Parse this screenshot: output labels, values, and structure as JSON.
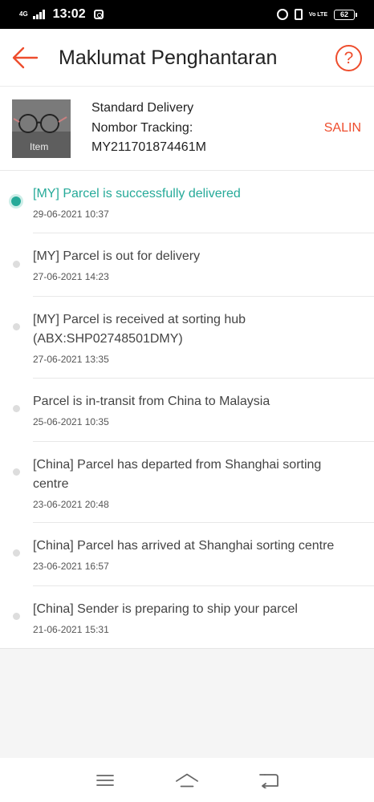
{
  "status_bar": {
    "network": "4G",
    "time": "13:02",
    "volte": "Vo LTE",
    "battery": "62"
  },
  "header": {
    "title": "Maklumat Penghantaran",
    "help_glyph": "?"
  },
  "shipment": {
    "thumbnail_overlay": "Item",
    "type": "Standard Delivery",
    "tracking_label": "Nombor Tracking:",
    "tracking_number": "MY211701874461M",
    "copy_label": "SALIN"
  },
  "events": [
    {
      "desc": "[MY] Parcel is successfully delivered",
      "time": "29-06-2021 10:37"
    },
    {
      "desc": "[MY] Parcel is out for delivery",
      "time": "27-06-2021 14:23"
    },
    {
      "desc": "[MY] Parcel is received at sorting hub (ABX:SHP02748501DMY)",
      "time": "27-06-2021 13:35"
    },
    {
      "desc": "Parcel is in-transit from China to Malaysia",
      "time": "25-06-2021 10:35"
    },
    {
      "desc": "[China] Parcel has departed from Shanghai sorting centre",
      "time": "23-06-2021 20:48"
    },
    {
      "desc": "[China] Parcel has arrived at Shanghai sorting centre",
      "time": "23-06-2021 16:57"
    },
    {
      "desc": "[China] Sender is preparing to ship your parcel",
      "time": "21-06-2021 15:31"
    }
  ],
  "colors": {
    "accent": "#ee4d2d",
    "active_status": "#26aa99"
  },
  "nav_icons": [
    "menu-icon",
    "home-icon",
    "back-nav-icon"
  ]
}
